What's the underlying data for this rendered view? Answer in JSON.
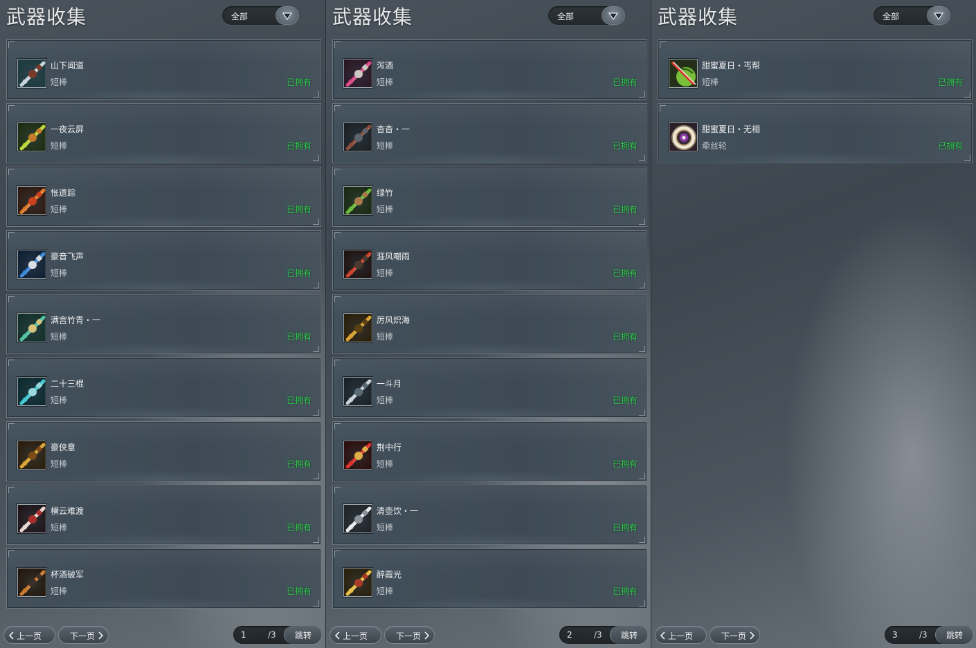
{
  "colors": {
    "owned": "#2ecb4b",
    "title": "#e6e9ec"
  },
  "panels": [
    {
      "title": "武器收集",
      "filter": "全部",
      "items": [
        {
          "name": "山下闻道",
          "type": "短棒",
          "status": "已拥有",
          "icon": "weapon-icon",
          "palette": [
            "#1c3a3f",
            "#c6d3d9",
            "#7a3a2a"
          ]
        },
        {
          "name": "一夜云屏",
          "type": "短棒",
          "status": "已拥有",
          "icon": "weapon-icon",
          "palette": [
            "#1d2e12",
            "#b8d43a",
            "#c37a2a"
          ]
        },
        {
          "name": "怅遗踪",
          "type": "短棒",
          "status": "已拥有",
          "icon": "weapon-icon",
          "palette": [
            "#2e1a10",
            "#e07a2a",
            "#c8421e"
          ]
        },
        {
          "name": "豪音飞声",
          "type": "短棒",
          "status": "已拥有",
          "icon": "weapon-icon",
          "palette": [
            "#102034",
            "#3a86d6",
            "#d8dde2"
          ]
        },
        {
          "name": "满宫竹青・一",
          "type": "短棒",
          "status": "已拥有",
          "icon": "weapon-icon",
          "palette": [
            "#12302a",
            "#4fc0a0",
            "#d6c27a"
          ]
        },
        {
          "name": "二十三棍",
          "type": "短棒",
          "status": "已拥有",
          "icon": "weapon-icon",
          "palette": [
            "#0c2a30",
            "#3fc8d0",
            "#9ad8de"
          ]
        },
        {
          "name": "豪侠意",
          "type": "短棒",
          "status": "已拥有",
          "icon": "weapon-icon",
          "palette": [
            "#2a1e0c",
            "#d8a234",
            "#7a4a18"
          ]
        },
        {
          "name": "横云难渡",
          "type": "短棒",
          "status": "已拥有",
          "icon": "weapon-icon",
          "palette": [
            "#1e1418",
            "#e8d6d0",
            "#a8302c"
          ]
        },
        {
          "name": "杯酒破军",
          "type": "短棒",
          "status": "已拥有",
          "icon": "weapon-icon",
          "palette": [
            "#24180c",
            "#c8762c",
            "#3a3028"
          ]
        }
      ],
      "pager": {
        "prev": "上一页",
        "next": "下一页",
        "page": "1",
        "total": "/3",
        "jump": "跳转"
      }
    },
    {
      "title": "武器收集",
      "filter": "全部",
      "items": [
        {
          "name": "泻酒",
          "type": "短棒",
          "status": "已拥有",
          "icon": "weapon-icon",
          "palette": [
            "#2a1624",
            "#d84a8a",
            "#d0c8c4"
          ]
        },
        {
          "name": "杳杳・一",
          "type": "短棒",
          "status": "已拥有",
          "icon": "weapon-icon",
          "palette": [
            "#1a2024",
            "#8a4a3a",
            "#5a646a"
          ]
        },
        {
          "name": "绿竹",
          "type": "短棒",
          "status": "已拥有",
          "icon": "weapon-icon",
          "palette": [
            "#1a2a12",
            "#6ab83a",
            "#a87a4a"
          ]
        },
        {
          "name": "涯风嘲雨",
          "type": "短棒",
          "status": "已拥有",
          "icon": "weapon-icon",
          "palette": [
            "#1e1210",
            "#c8402a",
            "#4a3a30"
          ]
        },
        {
          "name": "厉风炽海",
          "type": "短棒",
          "status": "已拥有",
          "icon": "weapon-icon",
          "palette": [
            "#2a1e0a",
            "#d8a030",
            "#5a4010"
          ]
        },
        {
          "name": "一斗月",
          "type": "短棒",
          "status": "已拥有",
          "icon": "weapon-icon",
          "palette": [
            "#1a2228",
            "#c8d2d8",
            "#5a6a74"
          ]
        },
        {
          "name": "荆中行",
          "type": "短棒",
          "status": "已拥有",
          "icon": "weapon-icon",
          "palette": [
            "#2a0e0c",
            "#d8302a",
            "#e0b048"
          ]
        },
        {
          "name": "清壶饮・一",
          "type": "短棒",
          "status": "已拥有",
          "icon": "weapon-icon",
          "palette": [
            "#202428",
            "#e8ecee",
            "#8a949a"
          ]
        },
        {
          "name": "醉霞光",
          "type": "短棒",
          "status": "已拥有",
          "icon": "weapon-icon",
          "palette": [
            "#2a200c",
            "#e8c048",
            "#a83a2a"
          ]
        }
      ],
      "pager": {
        "prev": "上一页",
        "next": "下一页",
        "page": "2",
        "total": "/3",
        "jump": "跳转"
      }
    },
    {
      "title": "武器收集",
      "filter": "全部",
      "items": [
        {
          "name": "甜蜜夏日・丐帮",
          "type": "短棒",
          "status": "已拥有",
          "icon": "watermelon-weapon-icon",
          "palette": [
            "#24301a",
            "#7ac03a",
            "#d8342a"
          ]
        },
        {
          "name": "甜蜜夏日・无相",
          "type": "牵丝轮",
          "status": "已拥有",
          "icon": "wheel-weapon-icon",
          "palette": [
            "#2a2228",
            "#f0e8d8",
            "#8a3aa8"
          ]
        }
      ],
      "pager": {
        "prev": "上一页",
        "next": "下一页",
        "page": "3",
        "total": "/3",
        "jump": "跳转"
      }
    }
  ]
}
